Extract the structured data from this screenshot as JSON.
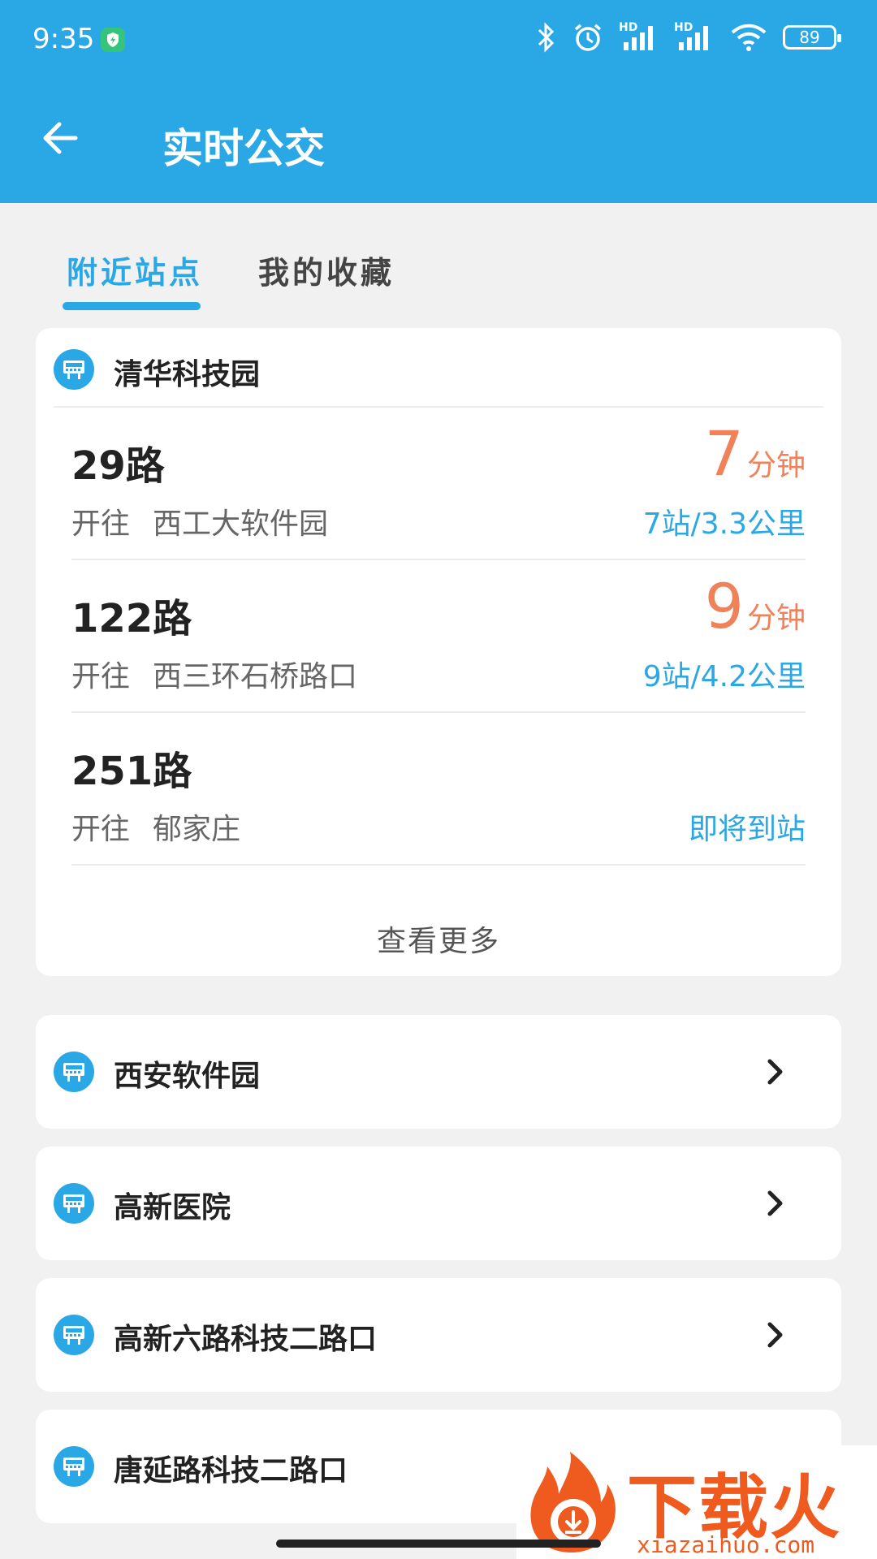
{
  "status": {
    "time": "9:35",
    "battery": "89",
    "hd1": "HD",
    "hd2": "HD"
  },
  "header": {
    "title": "实时公交"
  },
  "tabs": [
    {
      "label": "附近站点",
      "active": true
    },
    {
      "label": "我的收藏",
      "active": false
    }
  ],
  "main_station": {
    "name": "清华科技园",
    "routes": [
      {
        "name": "29路",
        "dir_label": "开往",
        "destination": "西工大软件园",
        "eta_value": "7",
        "eta_unit": "分钟",
        "distance": "7站/3.3公里"
      },
      {
        "name": "122路",
        "dir_label": "开往",
        "destination": "西三环石桥路口",
        "eta_value": "9",
        "eta_unit": "分钟",
        "distance": "9站/4.2公里"
      },
      {
        "name": "251路",
        "dir_label": "开往",
        "destination": "郁家庄",
        "status": "即将到站"
      }
    ],
    "more_label": "查看更多"
  },
  "stations": [
    {
      "name": "西安软件园"
    },
    {
      "name": "高新医院"
    },
    {
      "name": "高新六路科技二路口"
    },
    {
      "name": "唐延路科技二路口"
    }
  ],
  "watermark": {
    "text": "下载火",
    "url": "xiazaihuo.com"
  },
  "colors": {
    "primary": "#2aa8e6",
    "eta": "#f0825a",
    "watermark": "#ef5a1e"
  },
  "icons": {
    "back": "arrow-left-icon",
    "station": "bus-stop-icon",
    "chevron": "chevron-right-icon"
  }
}
